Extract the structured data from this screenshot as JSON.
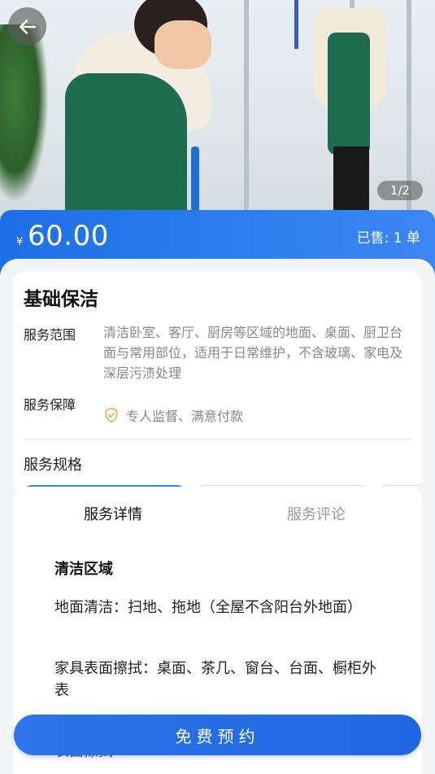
{
  "hero": {
    "pager": "1/2"
  },
  "price": {
    "currency": "¥",
    "amount": "60.00",
    "sold": "已售: 1 单"
  },
  "service": {
    "title": "基础保洁",
    "scope_label": "服务范围",
    "scope_text": "清洁卧室、客厅、厨房等区域的地面、桌面、厨卫台面与常用部位，适用于日常维护，不含玻璃、家电及深层污渍处理",
    "guarantee_label": "服务保障",
    "guarantee_text": "专人监督、满意付款",
    "spec_title": "服务规格"
  },
  "tabs": {
    "details": "服务详情",
    "reviews": "服务评论"
  },
  "details": {
    "heading": "清洁区域",
    "floor": "地面清洁：扫地、拖地（全屋不含阳台外地面）",
    "furniture": "家具表面擦拭：桌面、茶几、窗台、台面、橱柜外表",
    "partial": "表面擦拭"
  },
  "actions": {
    "book": "免费预约"
  },
  "colors": {
    "accent": "#1f6fe6",
    "guarantee_icon": "#f0a640"
  }
}
